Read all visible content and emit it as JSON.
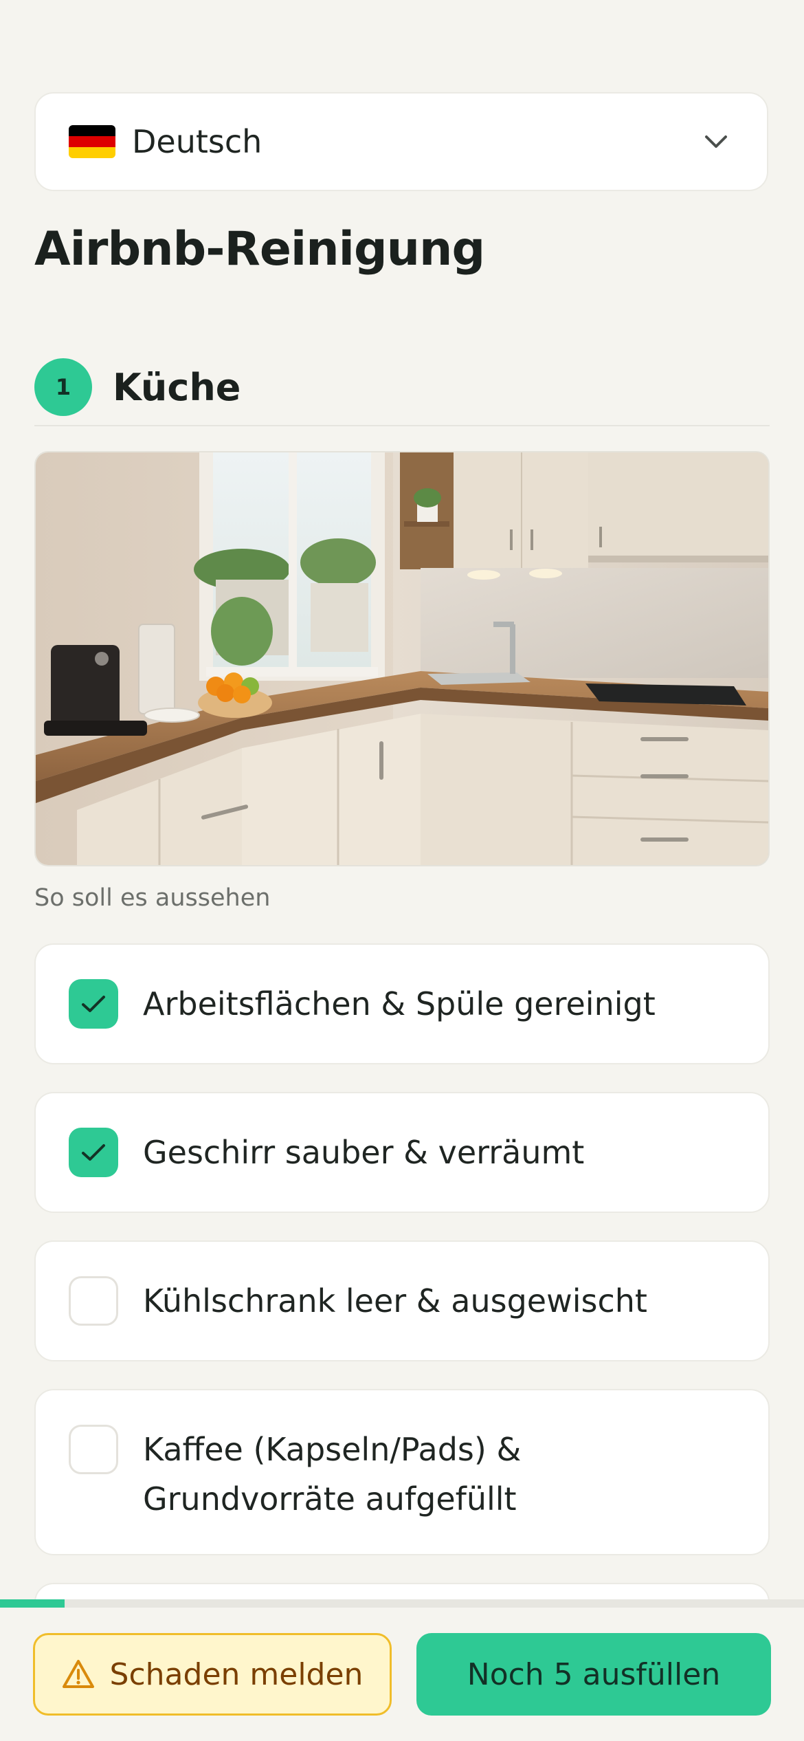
{
  "language": {
    "selected": "Deutsch",
    "flag_icon": "germany-flag-icon",
    "flag_colors": [
      "#000000",
      "#dd0000",
      "#ffce00"
    ]
  },
  "page": {
    "title": "Airbnb-Reinigung"
  },
  "section": {
    "number": "1",
    "title": "Küche",
    "image_caption": "So soll es aussehen"
  },
  "checklist": [
    {
      "label": "Arbeitsflächen & Spüle gereinigt",
      "checked": true
    },
    {
      "label": "Geschirr sauber & verräumt",
      "checked": true
    },
    {
      "label": "Kühlschrank leer & ausgewischt",
      "checked": false
    },
    {
      "label": "Kaffee (Kapseln/Pads) & Grundvorräte aufgefüllt",
      "checked": false
    }
  ],
  "progress": {
    "fraction": 0.08
  },
  "actions": {
    "report_damage": "Schaden melden",
    "submit": "Noch 5 ausfüllen"
  },
  "colors": {
    "accent": "#2ec994",
    "background": "#f5f4ef",
    "warning_bg": "#fff6cc",
    "warning_border": "#f0bd2a",
    "warning_text": "#7a3f00"
  }
}
